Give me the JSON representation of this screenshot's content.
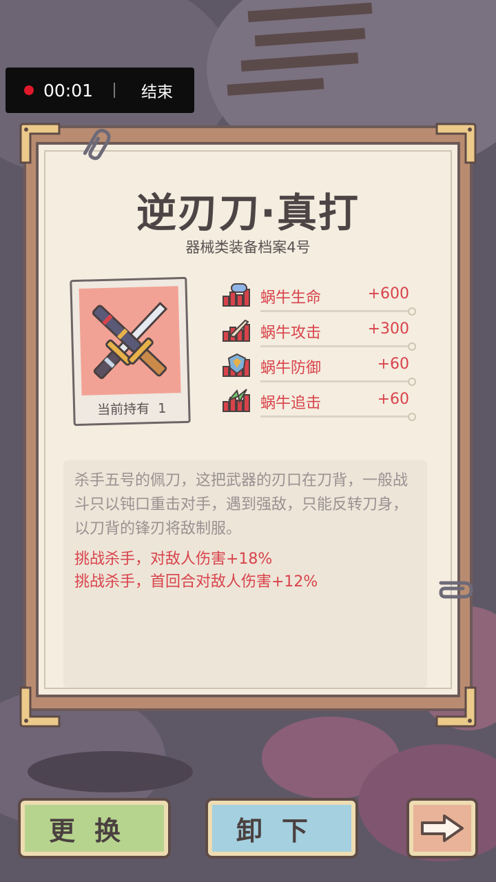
{
  "recording": {
    "time": "00:01",
    "end_label": "结束"
  },
  "equipment": {
    "title": "逆刃刀·真打",
    "subtitle": "器械类装备档案4号",
    "owned_label": "当前持有",
    "owned_count": "1",
    "stats": [
      {
        "icon": "hp-icon",
        "name": "蜗牛生命",
        "value": "+600"
      },
      {
        "icon": "sword-icon",
        "name": "蜗牛攻击",
        "value": "+300"
      },
      {
        "icon": "shield-icon",
        "name": "蜗牛防御",
        "value": "+60"
      },
      {
        "icon": "chase-icon",
        "name": "蜗牛追击",
        "value": "+60"
      }
    ],
    "description": "杀手五号的佩刀，这把武器的刃口在刀背，一般战斗只以钝口重击对手，遇到强敌，只能反转刀身，以刀背的锋刃将敌制服。",
    "effects": [
      "挑战杀手，对敌人伤害+18%",
      "挑战杀手，首回合对敌人伤害+12%"
    ]
  },
  "buttons": {
    "swap_label": "更换",
    "unload_label": "卸下"
  },
  "colors": {
    "accent_red": "#d8434b",
    "swap_green": "#b7d48e",
    "unload_blue": "#a4d0df",
    "next_orange": "#e8b398"
  }
}
